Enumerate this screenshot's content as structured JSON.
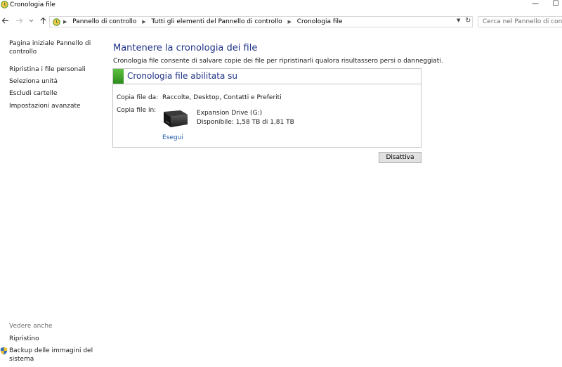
{
  "window": {
    "title": "Cronologia file",
    "minimize_glyph": "—",
    "maximize_glyph": "☐"
  },
  "nav": {
    "back_icon": "arrow-left-icon",
    "forward_icon": "arrow-right-icon",
    "up_icon": "arrow-up-icon",
    "breadcrumbs": [
      "Pannello di controllo",
      "Tutti gli elementi del Pannello di controllo",
      "Cronologia file"
    ],
    "search_placeholder": "Cerca nel Pannello di controllo"
  },
  "sidebar": {
    "home": "Pagina iniziale Pannello di controllo",
    "links": [
      "Ripristina i file personali",
      "Seleziona unità",
      "Escludi cartelle",
      "Impostazioni avanzate"
    ],
    "see_also_title": "Vedere anche",
    "see_also": [
      "Ripristino",
      "Backup delle immagini del sistema"
    ]
  },
  "main": {
    "title": "Mantenere la cronologia dei file",
    "description": "Cronologia file consente di salvare copie dei file per ripristinarli qualora risultassero persi o danneggiati.",
    "status_title": "Cronologia file abilitata su",
    "accent_color": "#3ea52a",
    "copy_from_label": "Copia file da:",
    "copy_from_value": "Raccolte, Desktop, Contatti e Preferiti",
    "copy_to_label": "Copia file in:",
    "drive_name": "Expansion Drive (G:)",
    "drive_free": "Disponibile: 1,58 TB di 1,81 TB",
    "run_link": "Esegui",
    "disable_button": "Disattiva"
  }
}
